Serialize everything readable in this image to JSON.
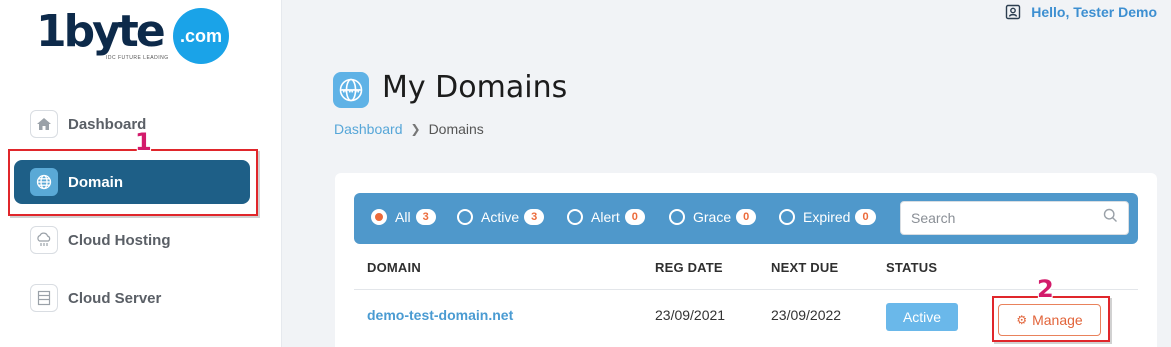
{
  "brand": {
    "logo_text": "1byte",
    "logo_domain": ".com",
    "tagline": "IDC FUTURE LEADING"
  },
  "sidebar": {
    "items": [
      {
        "label": "Dashboard",
        "icon": "home-icon",
        "active": false
      },
      {
        "label": "Domain",
        "icon": "globe-icon",
        "active": true
      },
      {
        "label": "Cloud Hosting",
        "icon": "cloud-icon",
        "active": false
      },
      {
        "label": "Cloud Server",
        "icon": "server-icon",
        "active": false
      }
    ]
  },
  "header": {
    "user_greeting": "Hello, Tester Demo"
  },
  "page": {
    "title": "My Domains",
    "icon": "www-globe-icon",
    "breadcrumb": [
      {
        "label": "Dashboard"
      },
      {
        "label": "Domains"
      }
    ]
  },
  "filters": [
    {
      "label": "All",
      "count": "3",
      "selected": true
    },
    {
      "label": "Active",
      "count": "3",
      "selected": false
    },
    {
      "label": "Alert",
      "count": "0",
      "selected": false
    },
    {
      "label": "Grace",
      "count": "0",
      "selected": false
    },
    {
      "label": "Expired",
      "count": "0",
      "selected": false
    }
  ],
  "search": {
    "placeholder": "Search",
    "value": ""
  },
  "table": {
    "columns": [
      "DOMAIN",
      "REG DATE",
      "NEXT DUE",
      "STATUS"
    ],
    "rows": [
      {
        "domain": "demo-test-domain.net",
        "reg_date": "23/09/2021",
        "next_due": "23/09/2022",
        "status": "Active",
        "action": "Manage"
      }
    ]
  },
  "annotations": {
    "marker_1": "1",
    "marker_2": "2"
  },
  "colors": {
    "sidebar_active": "#1e5f87",
    "filter_bar": "#4f98cb",
    "accent_orange": "#ec6b3b",
    "highlight_red": "#e0262b",
    "marker_magenta": "#d31b6b",
    "link_blue": "#4a9bd2"
  }
}
